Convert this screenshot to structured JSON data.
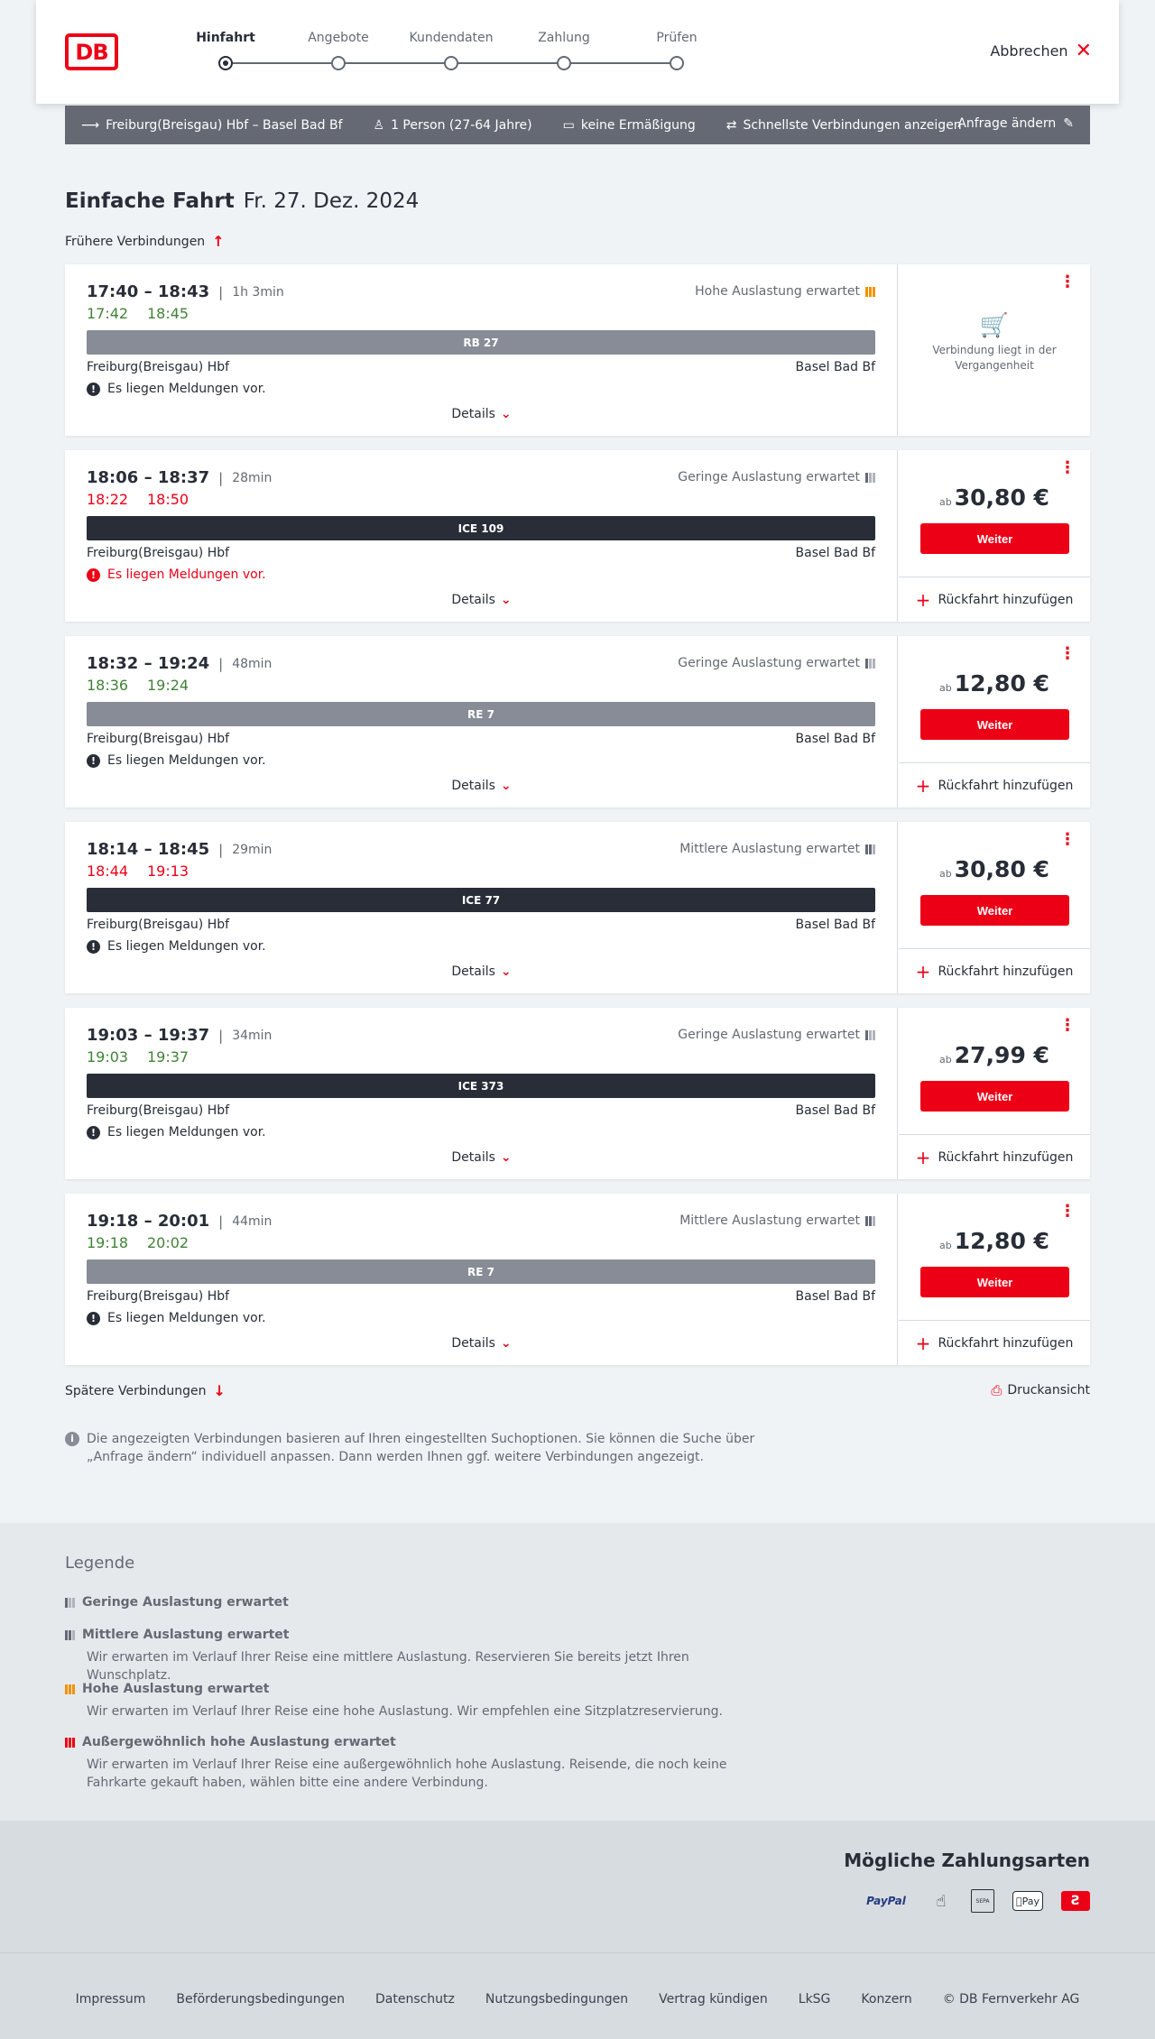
{
  "header": {
    "steps": [
      {
        "label": "Hinfahrt",
        "active": true
      },
      {
        "label": "Angebote",
        "active": false
      },
      {
        "label": "Kundendaten",
        "active": false
      },
      {
        "label": "Zahlung",
        "active": false
      },
      {
        "label": "Prüfen",
        "active": false
      }
    ],
    "logo": "DB",
    "cancel_label": "Abbrechen"
  },
  "filter": {
    "route": "Freiburg(Breisgau) Hbf – Basel Bad Bf",
    "persons": "1 Person (27-64 Jahre)",
    "discount": "keine Ermäßigung",
    "fastest": "Schnellste Verbindungen anzeigen",
    "edit": "Anfrage ändern"
  },
  "page": {
    "title": "Einfache Fahrt",
    "date": "Fr. 27. Dez. 2024",
    "earlier": "Frühere Verbindungen",
    "later": "Spätere Verbindungen",
    "print": "Druckansicht",
    "info": "Die angezeigten Verbindungen basieren auf Ihren eingestellten Suchoptionen. Sie können die Suche über „Anfrage ändern“ individuell anpassen. Dann werden Ihnen ggf. weitere Verbindungen angezeigt."
  },
  "connections": [
    {
      "times": "17:40 – 18:43",
      "duration": "1h 3min",
      "rt_dep": "17:42",
      "rt_arr": "18:45",
      "rt_status": "green",
      "load": "Hohe Auslastung erwartet",
      "load_level": "high",
      "train": "RB 27",
      "train_style": "grey",
      "from": "Freiburg(Breisgau) Hbf",
      "to": "Basel Bad Bf",
      "message": "Es liegen Meldungen vor.",
      "message_red": false,
      "details": "Details",
      "past": true,
      "past_text": "Verbindung liegt in der Vergangenheit"
    },
    {
      "times": "18:06 – 18:37",
      "duration": "28min",
      "rt_dep": "18:22",
      "rt_arr": "18:50",
      "rt_status": "red",
      "load": "Geringe Auslastung erwartet",
      "load_level": "low",
      "train": "ICE 109",
      "train_style": "dark",
      "from": "Freiburg(Breisgau) Hbf",
      "to": "Basel Bad Bf",
      "message": "Es liegen Meldungen vor.",
      "message_red": true,
      "details": "Details",
      "price_prefix": "ab",
      "price": "30,80 €",
      "cta": "Weiter",
      "return": "Rückfahrt hinzufügen"
    },
    {
      "times": "18:32 – 19:24",
      "duration": "48min",
      "rt_dep": "18:36",
      "rt_arr": "19:24",
      "rt_status": "green",
      "load": "Geringe Auslastung erwartet",
      "load_level": "low",
      "train": "RE 7",
      "train_style": "grey",
      "from": "Freiburg(Breisgau) Hbf",
      "to": "Basel Bad Bf",
      "message": "Es liegen Meldungen vor.",
      "message_red": false,
      "details": "Details",
      "price_prefix": "ab",
      "price": "12,80 €",
      "cta": "Weiter",
      "return": "Rückfahrt hinzufügen"
    },
    {
      "times": "18:14 – 18:45",
      "duration": "29min",
      "rt_dep": "18:44",
      "rt_arr": "19:13",
      "rt_status": "red",
      "load": "Mittlere Auslastung erwartet",
      "load_level": "medium",
      "train": "ICE 77",
      "train_style": "dark",
      "from": "Freiburg(Breisgau) Hbf",
      "to": "Basel Bad Bf",
      "message": "Es liegen Meldungen vor.",
      "message_red": false,
      "details": "Details",
      "price_prefix": "ab",
      "price": "30,80 €",
      "cta": "Weiter",
      "return": "Rückfahrt hinzufügen"
    },
    {
      "times": "19:03 – 19:37",
      "duration": "34min",
      "rt_dep": "19:03",
      "rt_arr": "19:37",
      "rt_status": "green",
      "load": "Geringe Auslastung erwartet",
      "load_level": "low",
      "train": "ICE 373",
      "train_style": "dark",
      "from": "Freiburg(Breisgau) Hbf",
      "to": "Basel Bad Bf",
      "message": "Es liegen Meldungen vor.",
      "message_red": false,
      "details": "Details",
      "price_prefix": "ab",
      "price": "27,99 €",
      "cta": "Weiter",
      "return": "Rückfahrt hinzufügen"
    },
    {
      "times": "19:18 – 20:01",
      "duration": "44min",
      "rt_dep": "19:18",
      "rt_arr": "20:02",
      "rt_status": "green",
      "load": "Mittlere Auslastung erwartet",
      "load_level": "medium",
      "train": "RE 7",
      "train_style": "grey",
      "from": "Freiburg(Breisgau) Hbf",
      "to": "Basel Bad Bf",
      "message": "Es liegen Meldungen vor.",
      "message_red": false,
      "details": "Details",
      "price_prefix": "ab",
      "price": "12,80 €",
      "cta": "Weiter",
      "return": "Rückfahrt hinzufügen"
    }
  ],
  "legend": {
    "title": "Legende",
    "items": [
      {
        "label": "Geringe Auslastung erwartet",
        "desc": "",
        "level": "low"
      },
      {
        "label": "Mittlere Auslastung erwartet",
        "desc": "Wir erwarten im Verlauf Ihrer Reise eine mittlere Auslastung. Reservieren Sie bereits jetzt Ihren Wunschplatz.",
        "level": "medium"
      },
      {
        "label": "Hohe Auslastung erwartet",
        "desc": "Wir erwarten im Verlauf Ihrer Reise eine hohe Auslastung. Wir empfehlen eine Sitzplatzreservierung.",
        "level": "high"
      },
      {
        "label": "Außergewöhnlich hohe Auslastung erwartet",
        "desc": "Wir erwarten im Verlauf Ihrer Reise eine außergewöhnlich hohe Auslastung. Reisende, die noch keine Fahrkarte gekauft haben, wählen bitte eine andere Verbindung.",
        "level": "extreme"
      }
    ]
  },
  "payment": {
    "title": "Mögliche Zahlungsarten",
    "paypal": "PayPal",
    "sepa": "SEPA",
    "apple": "Pay"
  },
  "footer": {
    "links": [
      "Impressum",
      "Beförderungsbedingungen",
      "Datenschutz",
      "Nutzungsbedingungen",
      "Vertrag kündigen",
      "LkSG",
      "Konzern",
      "© DB Fernverkehr AG"
    ]
  },
  "colors": {
    "accent": "#ec0016",
    "green": "#408335",
    "dark": "#282d37",
    "grey_bar": "#878c96"
  },
  "icons": [
    "route-arrow-icon",
    "person-icon",
    "card-icon",
    "settings-icon",
    "pencil-icon",
    "close-icon",
    "arrow-up-icon",
    "arrow-down-icon",
    "chevron-down-icon",
    "kebab-icon",
    "plus-icon",
    "alert-icon",
    "info-icon",
    "print-icon",
    "cart-icon",
    "occupancy-icon"
  ]
}
